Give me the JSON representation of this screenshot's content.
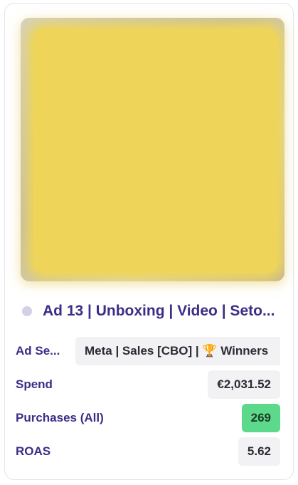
{
  "card": {
    "title": "Ad 13 | Unboxing | Video | Seto...",
    "status_icon": "status-dot",
    "fields": [
      {
        "label": "Ad Se...",
        "value": "Meta | Sales [CBO] | 🏆 Winners"
      },
      {
        "label": "Spend",
        "value": "€2,031.52"
      },
      {
        "label": "Purchases (All)",
        "value": "269",
        "highlight": "#5cd98a"
      },
      {
        "label": "ROAS",
        "value": "5.62"
      }
    ]
  }
}
